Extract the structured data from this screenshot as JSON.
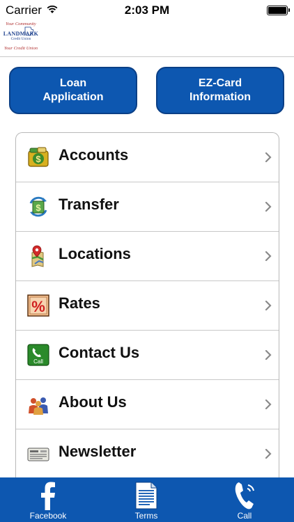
{
  "status_bar": {
    "carrier": "Carrier",
    "time": "2:03 PM"
  },
  "header": {
    "logo": {
      "tagline_top": "Your Community",
      "name": "LANDMARK",
      "subname": "Credit Union",
      "tagline_bottom": "Your Credit Union"
    }
  },
  "top_buttons": {
    "loan": {
      "line1": "Loan",
      "line2": "Application"
    },
    "ezcard": {
      "line1": "EZ-Card",
      "line2": "Information"
    }
  },
  "menu": {
    "items": [
      {
        "label": "Accounts",
        "icon": "money-bag-icon"
      },
      {
        "label": "Transfer",
        "icon": "transfer-icon"
      },
      {
        "label": "Locations",
        "icon": "map-pin-icon"
      },
      {
        "label": "Rates",
        "icon": "percent-icon"
      },
      {
        "label": "Contact Us",
        "icon": "phone-call-icon"
      },
      {
        "label": "About Us",
        "icon": "people-icon"
      },
      {
        "label": "Newsletter",
        "icon": "newsletter-icon"
      }
    ]
  },
  "tabbar": {
    "facebook": "Facebook",
    "terms": "Terms",
    "call": "Call"
  },
  "colors": {
    "brand_blue": "#0d57b0",
    "logo_red": "#b03030",
    "logo_navy": "#1a3e8c"
  }
}
